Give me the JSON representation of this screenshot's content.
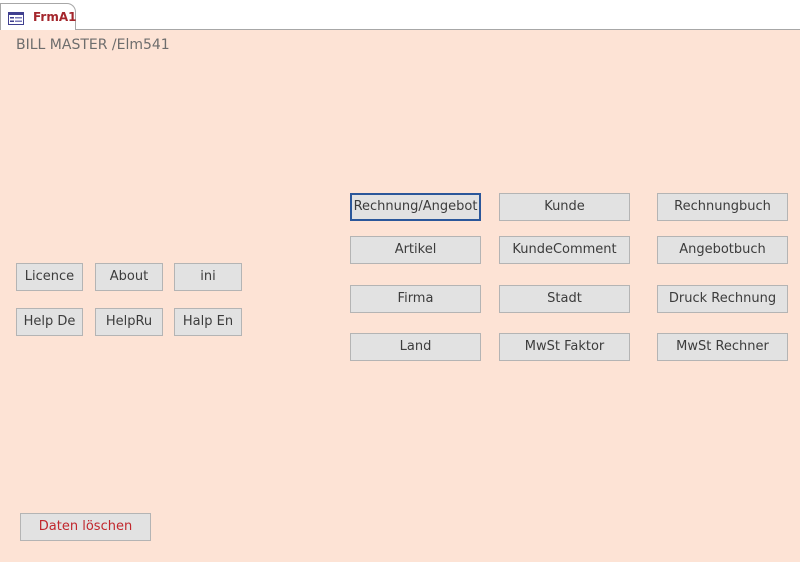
{
  "tab": {
    "label": "FrmA1",
    "icon": "form-icon"
  },
  "form": {
    "title": "BILL MASTER /Elm541",
    "background": "#fde3d5"
  },
  "left_buttons": {
    "licence": "Licence",
    "about": "About",
    "ini": "ini",
    "help_de": "Help De",
    "help_ru": "HelpRu",
    "help_en": "Halp En"
  },
  "main_buttons": {
    "rechnung_angebot": "Rechnung/Angebot",
    "kunde": "Kunde",
    "rechnungbuch": "Rechnungbuch",
    "artikel": "Artikel",
    "kunde_comment": "KundeComment",
    "angebotbuch": "Angebotbuch",
    "firma": "Firma",
    "stadt": "Stadt",
    "druck_rechnung": "Druck Rechnung",
    "land": "Land",
    "mwst_faktor": "MwSt Faktor",
    "mwst_rechner": "MwSt Rechner"
  },
  "footer": {
    "daten_loeschen": "Daten löschen"
  },
  "colors": {
    "accent": "#a4262c",
    "focus_border": "#2b579a",
    "danger_text": "#c1272d"
  }
}
